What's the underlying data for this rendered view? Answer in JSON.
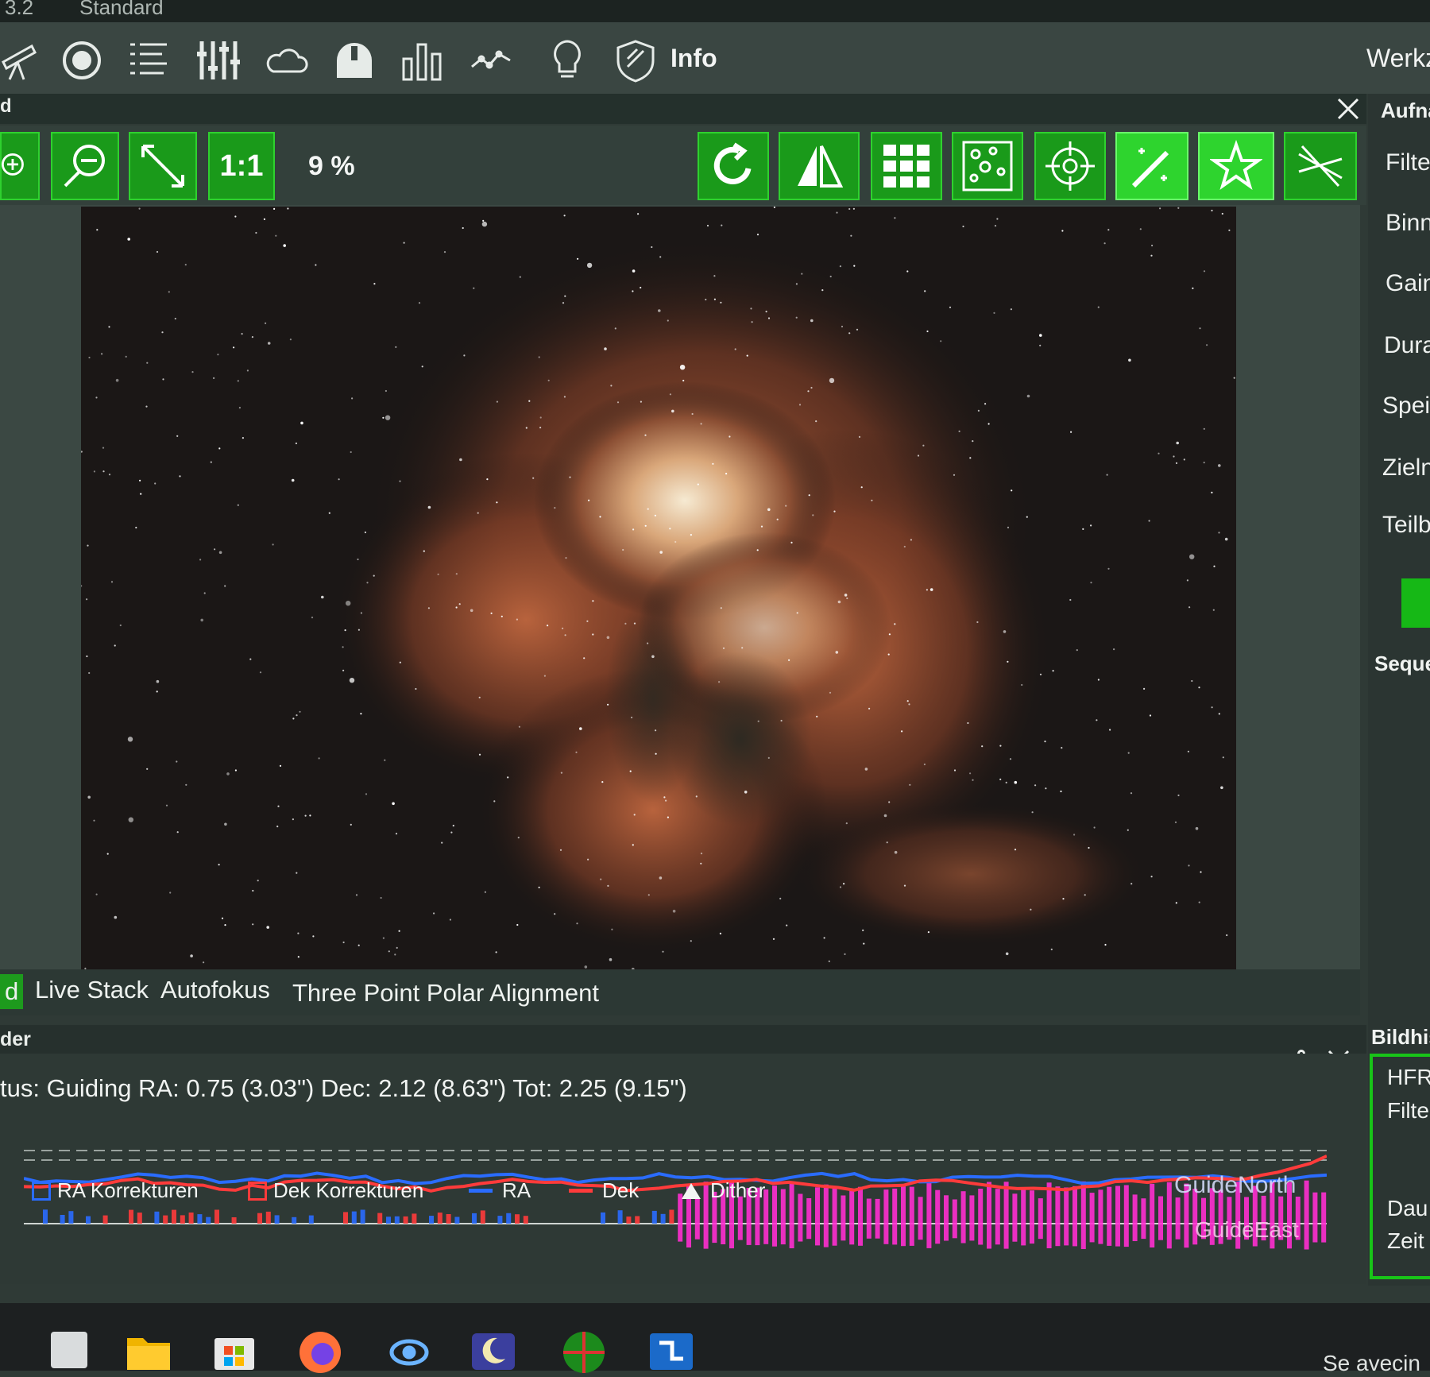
{
  "top_strip": {
    "left_text": "3.2",
    "right_text": "Standard"
  },
  "nav": {
    "icons": [
      "telescope-icon",
      "target-icon",
      "list-icon",
      "sliders-icon",
      "cloud-icon",
      "observatory-icon",
      "bar-chart-icon",
      "graph-icon",
      "lightbulb-icon",
      "shield-icon"
    ],
    "info_label": "Info",
    "right_label": "Werkz"
  },
  "panel_header": {
    "label": "d"
  },
  "toolbar": {
    "one_to_one": "1:1",
    "zoom": "9 %"
  },
  "tabs": [
    {
      "label": "d"
    },
    {
      "label": "Live Stack"
    },
    {
      "label": "Autofokus"
    },
    {
      "label": "Three Point Polar Alignment"
    }
  ],
  "guider": {
    "header": "der",
    "status": "tus: Guiding  RA: 0.75 (3.03\")  Dec: 2.12 (8.63\")  Tot: 2.25 (9.15\")",
    "legend": {
      "ra_corr": "RA Korrekturen",
      "dek_corr": "Dek Korrekturen",
      "ra": "RA",
      "dek": "Dek",
      "dither": "Dither"
    },
    "overlay_north": "GuideNorth",
    "overlay_east": "GuideEast",
    "colors": {
      "ra": "#2a6cff",
      "dek": "#ff3b3b",
      "corr": "#ff2fd0"
    }
  },
  "right_panel": {
    "header": "Aufna",
    "items": [
      "Filte",
      "Binn",
      "Gain",
      "Dura",
      "Spei",
      "Zieln",
      "Teilb"
    ],
    "sequence_header": "Seque",
    "history_header": "Bildhis",
    "history_items": [
      "HFR",
      "Filte",
      "Dau",
      "Zeit"
    ]
  },
  "taskbar": {
    "icons": [
      "start-icon",
      "file-explorer-icon",
      "store-icon",
      "firefox-icon",
      "nina-icon",
      "stellarium-icon",
      "phd2-icon",
      "network-icon"
    ],
    "right_text": "Se avecin"
  }
}
